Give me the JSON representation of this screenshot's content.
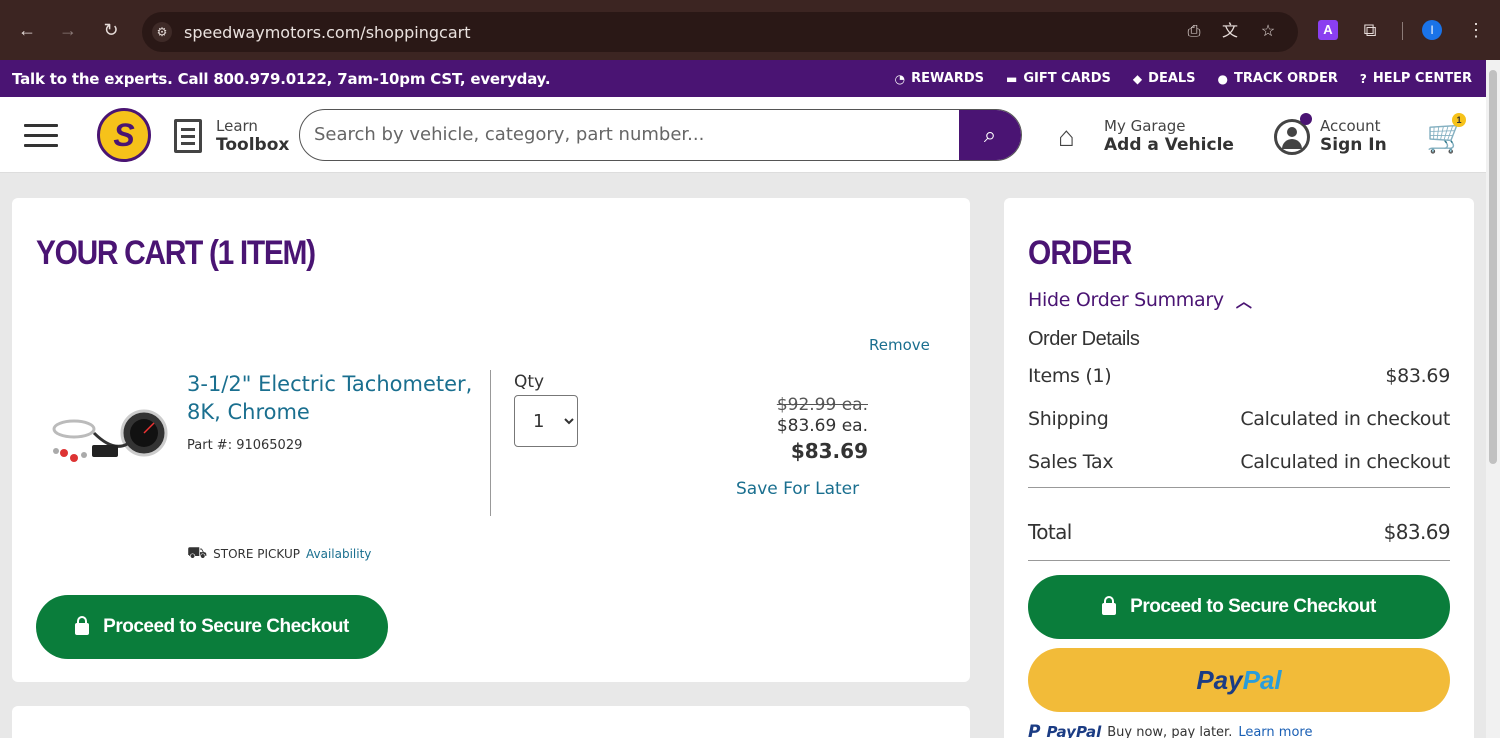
{
  "browser": {
    "url": "speedwaymotors.com/shoppingcart",
    "extension_letter": "A",
    "profile_letter": "I"
  },
  "promo": {
    "text": "Talk to the experts. Call 800.979.0122, 7am-10pm CST, everyday.",
    "links": [
      "REWARDS",
      "GIFT CARDS",
      "DEALS",
      "TRACK ORDER",
      "HELP CENTER"
    ]
  },
  "header": {
    "logo_letter": "S",
    "toolbox_small": "Learn",
    "toolbox_big": "Toolbox",
    "search_placeholder": "Search by vehicle, category, part number...",
    "garage_small": "My Garage",
    "garage_big": "Add a Vehicle",
    "account_small": "Account",
    "account_big": "Sign In",
    "cart_count": "1"
  },
  "cart": {
    "title": "YOUR CART (1 ITEM)",
    "remove_label": "Remove",
    "item": {
      "name": "3-1/2\" Electric Tachometer, 8K, Chrome",
      "part_number": "Part #: 91065029",
      "qty_label": "Qty",
      "qty_value": "1",
      "price_old": "$92.99 ea.",
      "price_each": "$83.69 ea.",
      "price_total": "$83.69",
      "save_later": "Save For Later",
      "pickup_label": "STORE PICKUP",
      "pickup_link": "Availability"
    },
    "checkout_label": "Proceed to Secure Checkout"
  },
  "order": {
    "title": "ORDER",
    "hide_summary": "Hide Order Summary",
    "details_heading": "Order Details",
    "items_label": "Items (1)",
    "items_value": "$83.69",
    "shipping_label": "Shipping",
    "shipping_value": "Calculated in checkout",
    "tax_label": "Sales Tax",
    "tax_value": "Calculated in checkout",
    "total_label": "Total",
    "total_value": "$83.69",
    "checkout_label": "Proceed to Secure Checkout",
    "paypal_part1": "Pay",
    "paypal_part2": "Pal",
    "paylater_brand": "PayPal",
    "paylater_text": "Buy now, pay later.",
    "paylater_link": "Learn more"
  },
  "colors": {
    "brand_purple": "#4a1473",
    "checkout_green": "#0a7d3b",
    "paypal_yellow": "#f2bb39",
    "link_blue": "#1a6f8f"
  }
}
